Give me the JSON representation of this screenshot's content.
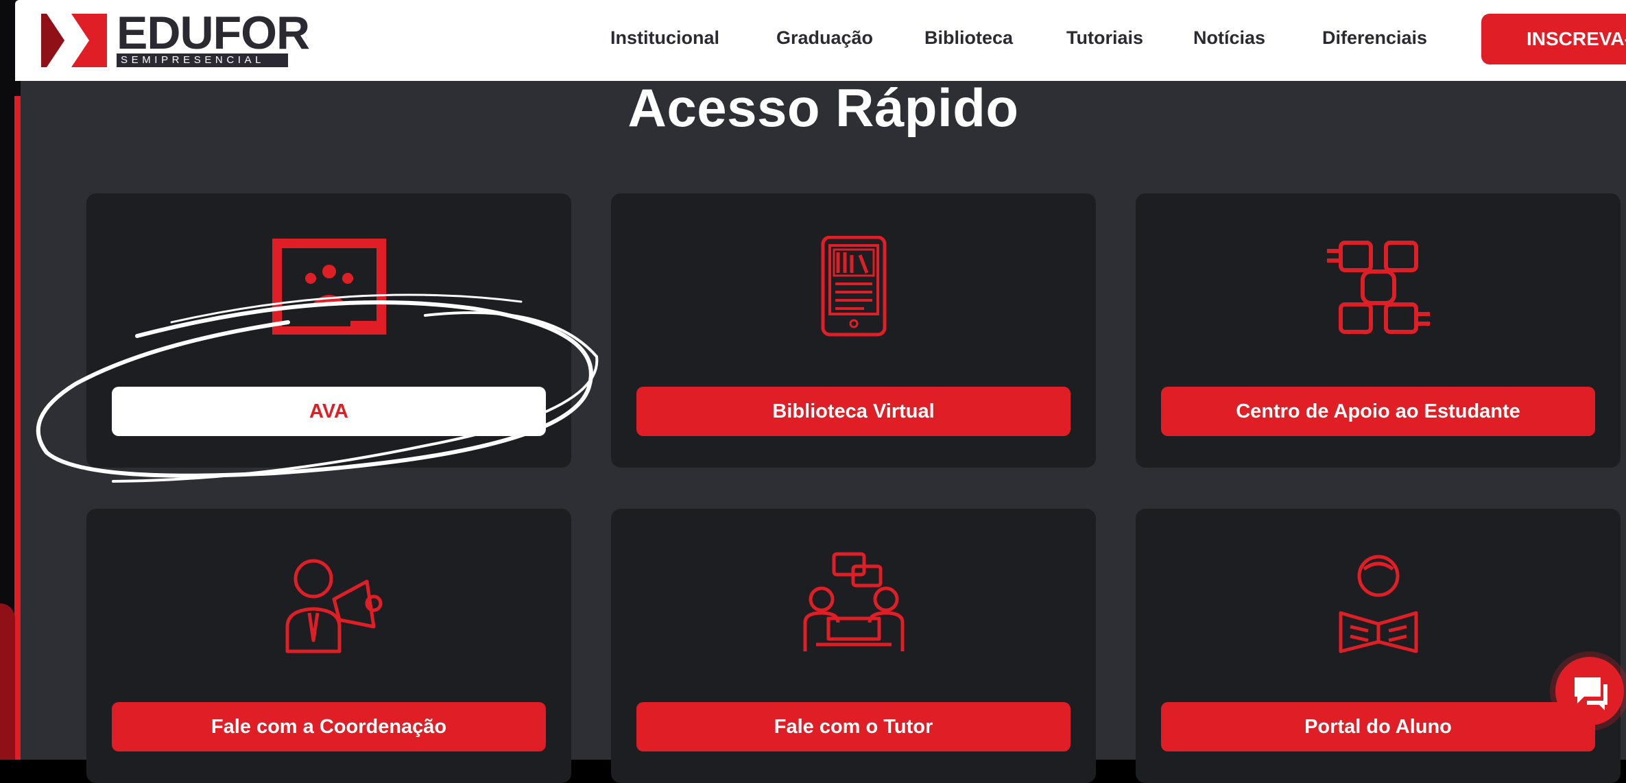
{
  "brand": {
    "name": "EDUFOR",
    "tagline": "SEMIPRESENCIAL"
  },
  "nav": {
    "items": [
      "Institucional",
      "Graduação",
      "Biblioteca",
      "Tutoriais",
      "Notícias",
      "Diferenciais"
    ],
    "cta_label": "INSCREVA-SE"
  },
  "main": {
    "title": "Acesso Rápido",
    "cards": [
      {
        "label": "AVA",
        "icon": "classroom-board-icon",
        "active": true
      },
      {
        "label": "Biblioteca Virtual",
        "icon": "tablet-library-icon",
        "active": false
      },
      {
        "label": "Centro de Apoio ao Estudante",
        "icon": "hands-teamwork-icon",
        "active": false
      },
      {
        "label": "Fale com a Coordenação",
        "icon": "megaphone-person-icon",
        "active": false
      },
      {
        "label": "Fale com o Tutor",
        "icon": "chat-meeting-icon",
        "active": false
      },
      {
        "label": "Portal do Aluno",
        "icon": "student-reading-icon",
        "active": false
      }
    ]
  },
  "colors": {
    "accent": "#e01e26",
    "card_bg": "#1d1e22",
    "page_bg": "#2e2f35",
    "header_text": "#2b2a33"
  },
  "chat_widget": {
    "icon": "chat-bubble-icon"
  }
}
